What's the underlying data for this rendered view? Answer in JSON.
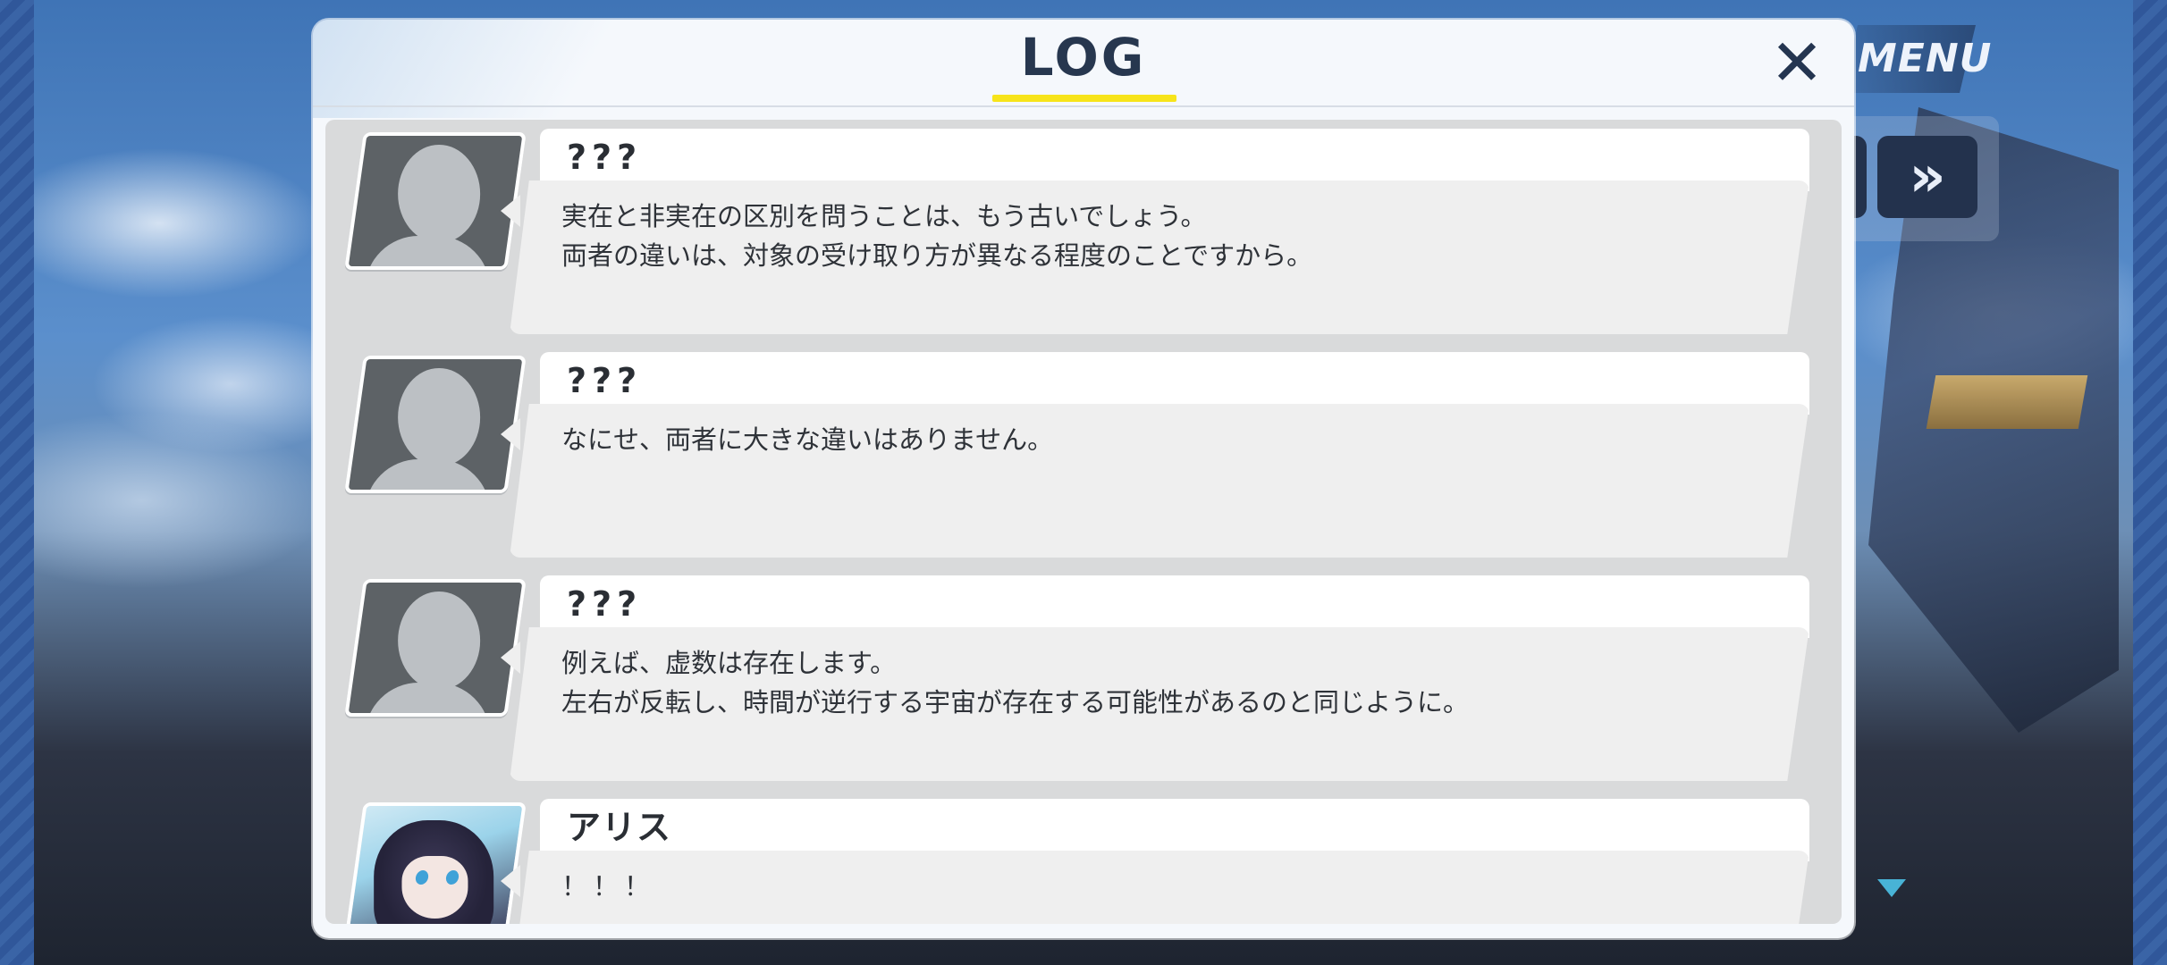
{
  "hud": {
    "menu_label": "MENU",
    "fast_forward_label": "»"
  },
  "dialog": {
    "title": "LOG",
    "close_label": "✕"
  },
  "entries": [
    {
      "speaker": "???",
      "text": "実在と非実在の区別を問うことは、もう古いでしょう。\n両者の違いは、対象の受け取り方が異なる程度のことですから。",
      "portrait": "silhouette"
    },
    {
      "speaker": "???",
      "text": "なにせ、両者に大きな違いはありません。",
      "portrait": "silhouette"
    },
    {
      "speaker": "???",
      "text": "例えば、虚数は存在します。\n左右が反転し、時間が逆行する宇宙が存在する可能性があるのと同じように。",
      "portrait": "silhouette"
    },
    {
      "speaker": "アリス",
      "text": "！！！",
      "portrait": "alice"
    }
  ],
  "colors": {
    "title_underline": "#f7e41a",
    "dialog_bg": "#f5f8fc",
    "log_bg": "#d9dadb",
    "bubble_bg": "#efefef",
    "accent_arrow": "#48b3d6"
  }
}
